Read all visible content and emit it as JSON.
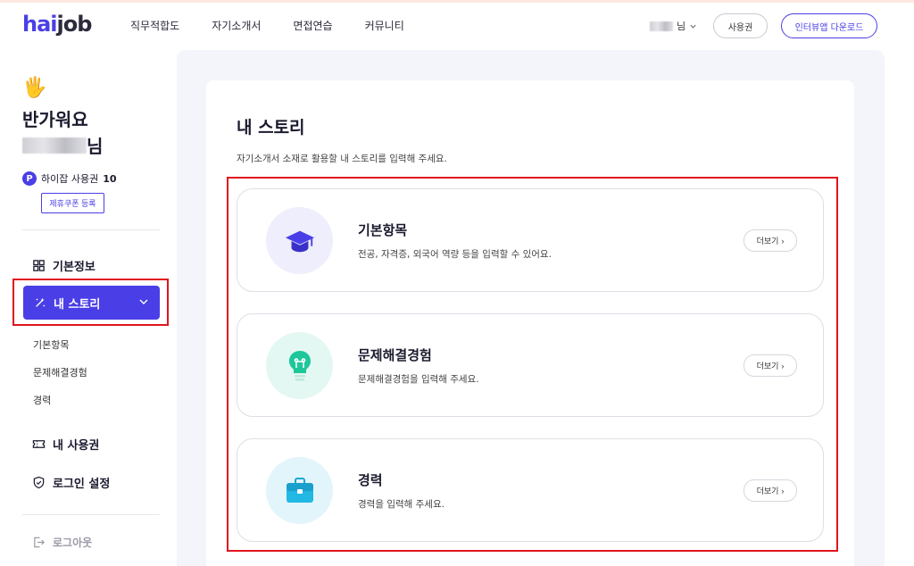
{
  "header": {
    "logo_prefix": "hai",
    "logo_suffix": "job",
    "nav": [
      "직무적합도",
      "자기소개서",
      "면접연습",
      "커뮤니티"
    ],
    "user_suffix": "님",
    "ticket_label": "사용권",
    "download_label": "인터뷰앱 다운로드"
  },
  "sidebar": {
    "greeting": "반가워요",
    "user_suffix": "님",
    "points_label": "하이잡 사용권",
    "points_count": "10",
    "coupon_label": "제휴쿠폰 등록",
    "items": {
      "basic_info": "기본정보",
      "my_story": "내 스토리",
      "my_ticket": "내 사용권",
      "login_settings": "로그인 설정",
      "logout": "로그아웃"
    },
    "sub_items": [
      "기본항목",
      "문제해결경험",
      "경력"
    ]
  },
  "main": {
    "title": "내 스토리",
    "description": "자기소개서 소재로 활용할 내 스토리를 입력해 주세요.",
    "cards": [
      {
        "title": "기본항목",
        "desc": "전공, 자격증, 외국어 역량 등을 입력할 수 있어요.",
        "more": "더보기",
        "icon": "graduation-cap-icon"
      },
      {
        "title": "문제해결경험",
        "desc": "문제해결경험을 입력해 주세요.",
        "more": "더보기",
        "icon": "lightbulb-icon"
      },
      {
        "title": "경력",
        "desc": "경력을 입력해 주세요.",
        "more": "더보기",
        "icon": "briefcase-icon"
      }
    ]
  },
  "colors": {
    "brand": "#4a3fe6",
    "highlight": "#e0141e",
    "main_bg": "#f4f4fb"
  }
}
